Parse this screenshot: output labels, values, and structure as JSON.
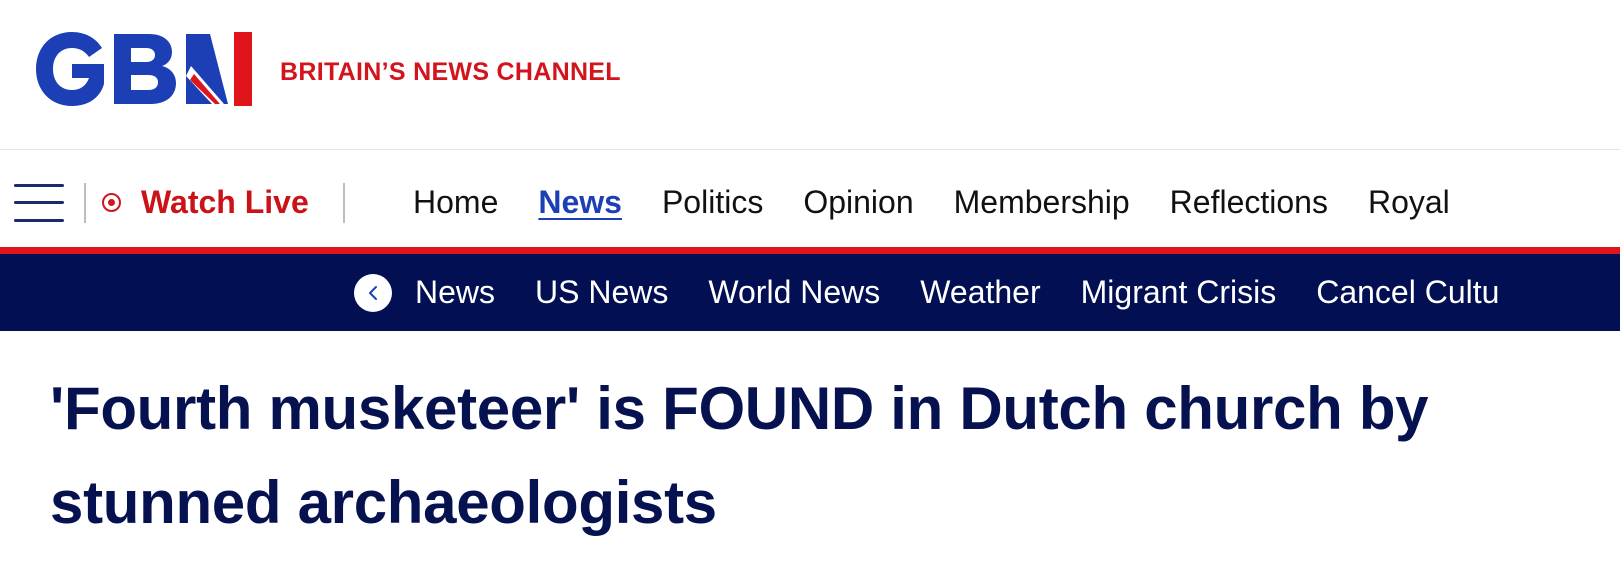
{
  "brand": {
    "tagline": "BRITAIN’S NEWS CHANNEL",
    "logo_icon": "gbn-logo",
    "colors": {
      "navy": "#020f52",
      "red": "#d4141c",
      "blue": "#1d3fb6"
    }
  },
  "main_nav": {
    "menu_icon": "hamburger-menu-icon",
    "watch_live": "Watch Live",
    "items": [
      {
        "label": "Home",
        "active": false
      },
      {
        "label": "News",
        "active": true
      },
      {
        "label": "Politics",
        "active": false
      },
      {
        "label": "Opinion",
        "active": false
      },
      {
        "label": "Membership",
        "active": false
      },
      {
        "label": "Reflections",
        "active": false
      },
      {
        "label": "Royal",
        "active": false
      }
    ]
  },
  "sub_nav": {
    "back_icon": "chevron-left-icon",
    "items": [
      "News",
      "US News",
      "World News",
      "Weather",
      "Migrant Crisis",
      "Cancel Cultu"
    ]
  },
  "article": {
    "headline": "'Fourth musketeer' is FOUND in Dutch church by stunned archaeologists"
  }
}
